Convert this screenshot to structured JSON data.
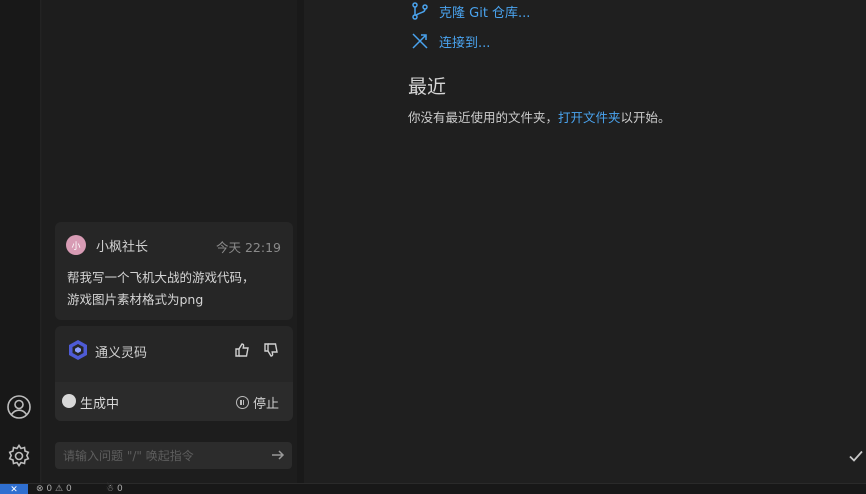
{
  "colors": {
    "link": "#4aa3ee",
    "accent": "#2f6fd0",
    "avatar": "#d79bb4"
  },
  "main": {
    "clone_git": "克隆 Git 仓库...",
    "connect_to": "连接到...",
    "recent_title": "最近",
    "recent_prefix": "你没有最近使用的文件夹，",
    "open_folder": "打开文件夹",
    "recent_suffix": "以开始。"
  },
  "chat": {
    "user": {
      "avatar_text": "小",
      "name": "小枫社长",
      "time": "今天 22:19"
    },
    "message_line1": "帮我写一个飞机大战的游戏代码，",
    "message_line2": "游戏图片素材格式为png",
    "assistant": {
      "name": "通义灵码",
      "status": "生成中",
      "stop": "停止"
    },
    "input_placeholder": "请输入问题 \"/\" 唤起指令"
  },
  "activity_bar": {
    "account_icon": "account-icon",
    "settings_icon": "gear-icon"
  },
  "status_bar": {
    "remote_icon": "remote-icon",
    "errors": "0",
    "warnings": "0",
    "ports": "0"
  }
}
